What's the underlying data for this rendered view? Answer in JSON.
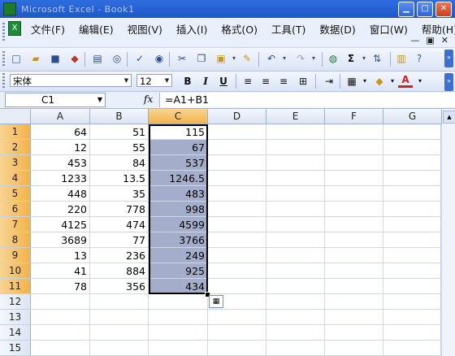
{
  "window": {
    "title": "Microsoft Excel - Book1"
  },
  "menu": {
    "items": [
      "文件(F)",
      "编辑(E)",
      "视图(V)",
      "插入(I)",
      "格式(O)",
      "工具(T)",
      "数据(D)",
      "窗口(W)",
      "帮助(H)"
    ]
  },
  "toolbar": {
    "font_name": "宋体",
    "font_size": "12",
    "bold_label": "B",
    "italic_label": "I",
    "underline_label": "U",
    "sigma_label": "Σ",
    "fontcolor_label": "A"
  },
  "formula_bar": {
    "name_box": "C1",
    "fx_label": "fx",
    "formula": "=A1+B1"
  },
  "sheet": {
    "columns": [
      "A",
      "B",
      "C",
      "D",
      "E",
      "F",
      "G"
    ],
    "selected_column": "C",
    "rows": [
      {
        "n": "1",
        "A": "64",
        "B": "51",
        "C": "115"
      },
      {
        "n": "2",
        "A": "12",
        "B": "55",
        "C": "67"
      },
      {
        "n": "3",
        "A": "453",
        "B": "84",
        "C": "537"
      },
      {
        "n": "4",
        "A": "1233",
        "B": "13.5",
        "C": "1246.5"
      },
      {
        "n": "5",
        "A": "448",
        "B": "35",
        "C": "483"
      },
      {
        "n": "6",
        "A": "220",
        "B": "778",
        "C": "998"
      },
      {
        "n": "7",
        "A": "4125",
        "B": "474",
        "C": "4599"
      },
      {
        "n": "8",
        "A": "3689",
        "B": "77",
        "C": "3766"
      },
      {
        "n": "9",
        "A": "13",
        "B": "236",
        "C": "249"
      },
      {
        "n": "10",
        "A": "41",
        "B": "884",
        "C": "925"
      },
      {
        "n": "11",
        "A": "78",
        "B": "356",
        "C": "434"
      },
      {
        "n": "12",
        "A": "",
        "B": "",
        "C": ""
      },
      {
        "n": "13",
        "A": "",
        "B": "",
        "C": ""
      },
      {
        "n": "14",
        "A": "",
        "B": "",
        "C": ""
      },
      {
        "n": "15",
        "A": "",
        "B": "",
        "C": ""
      }
    ]
  },
  "colors": {
    "selection_fill": "#a4aecb",
    "header_highlight": "#f2b34a",
    "titlebar": "#1f56c8"
  }
}
